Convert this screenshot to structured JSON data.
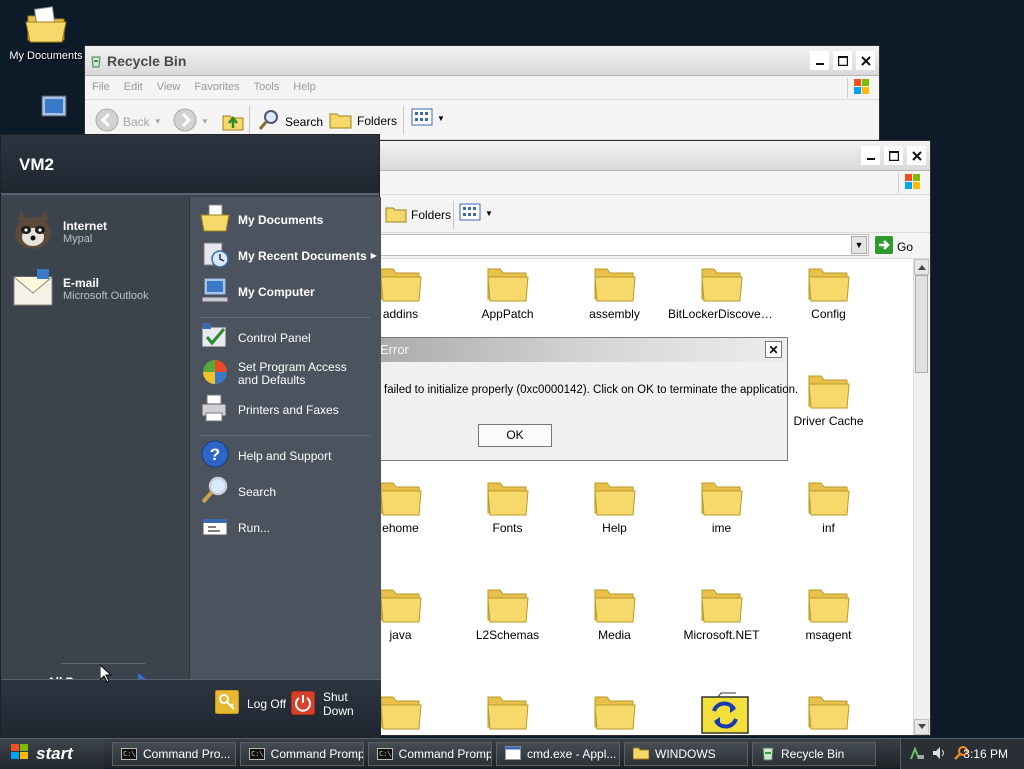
{
  "desktop": {
    "icons": [
      {
        "label": "My Documents",
        "icon": "my-documents-icon"
      },
      {
        "label": "",
        "icon": "my-computer-icon"
      }
    ]
  },
  "recycle_bin_window": {
    "title": "Recycle Bin",
    "menu": [
      "File",
      "Edit",
      "View",
      "Favorites",
      "Tools",
      "Help"
    ],
    "toolbar": {
      "back": "Back",
      "search": "Search",
      "folders": "Folders"
    }
  },
  "windows_window": {
    "toolbar": {
      "folders": "Folders"
    },
    "go_label": "Go",
    "folders": [
      [
        "addins",
        "AppPatch",
        "assembly",
        "BitLockerDiscovery...",
        "Config"
      ],
      [
        "",
        "",
        "",
        "",
        "Driver Cache"
      ],
      [
        "ehome",
        "Fonts",
        "Help",
        "ime",
        "inf"
      ],
      [
        "java",
        "L2Schemas",
        "Media",
        "Microsoft.NET",
        "msagent"
      ],
      [
        "",
        "",
        "",
        "",
        ""
      ]
    ]
  },
  "error_dialog": {
    "title": "Error",
    "message": "failed to initialize properly (0xc0000142). Click on OK to terminate the application.",
    "ok_label": "OK"
  },
  "start_menu": {
    "user": "VM2",
    "pinned": [
      {
        "label": "Internet",
        "sub": "Mypal",
        "icon": "mypal-raccoon-icon"
      },
      {
        "label": "E-mail",
        "sub": "Microsoft Outlook",
        "icon": "outlook-envelope-icon"
      }
    ],
    "all_programs": "All Programs",
    "right": {
      "my_documents": "My Documents",
      "my_recent_documents": "My Recent Documents",
      "my_computer": "My Computer",
      "control_panel": "Control Panel",
      "set_program_access": "Set Program Access and Defaults",
      "printers_faxes": "Printers and Faxes",
      "help_support": "Help and Support",
      "search": "Search",
      "run": "Run..."
    },
    "log_off": "Log Off",
    "shut_down": "Shut Down"
  },
  "taskbar": {
    "start": "start",
    "tasks": [
      {
        "label": "Command Pro...",
        "icon": "cmd-icon"
      },
      {
        "label": "Command Prompt",
        "icon": "cmd-icon"
      },
      {
        "label": "Command Prompt",
        "icon": "cmd-icon"
      },
      {
        "label": "cmd.exe - Appl...",
        "icon": "app-window-icon"
      },
      {
        "label": "WINDOWS",
        "icon": "folder-icon"
      },
      {
        "label": "Recycle Bin",
        "icon": "recycle-bin-icon"
      }
    ],
    "clock": "3:16 PM"
  },
  "colors": {
    "desktop": "#0d1a28",
    "start_menu_bg": "#3d4651",
    "folder_yellow": "#f7d96b"
  }
}
